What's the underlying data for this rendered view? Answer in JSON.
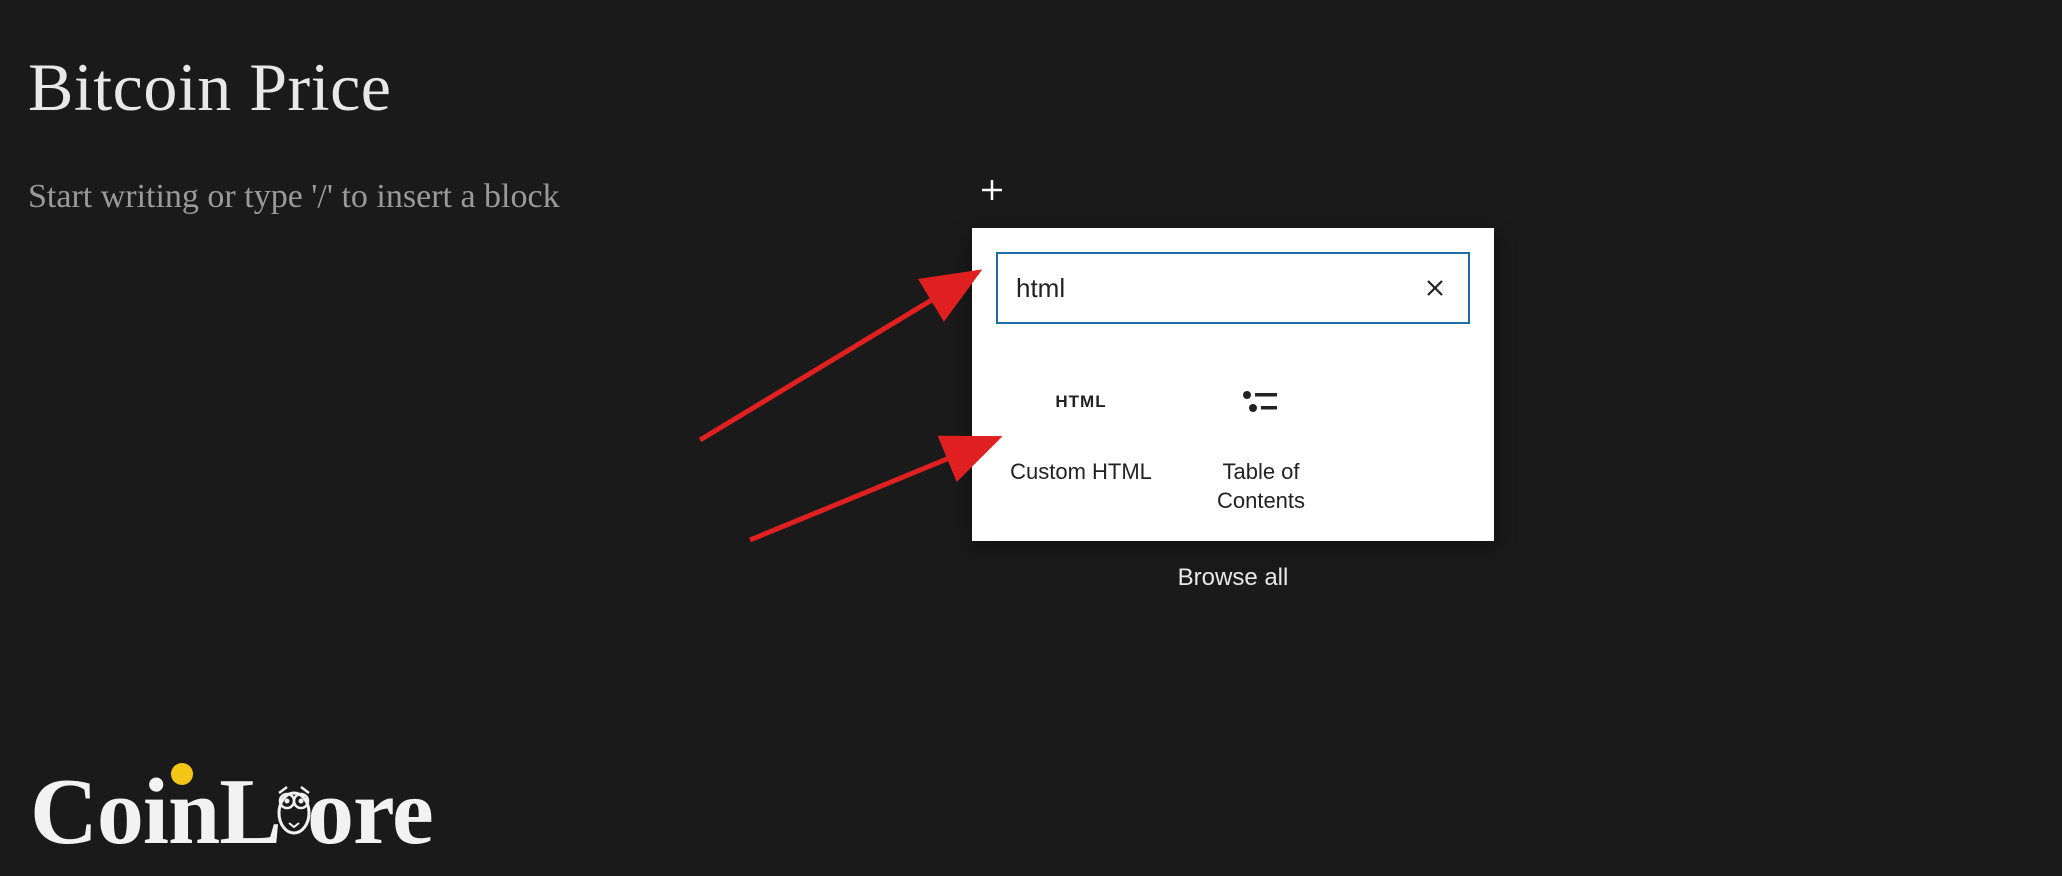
{
  "editor": {
    "page_title": "Bitcoin Price",
    "placeholder": "Start writing or type '/' to insert a block"
  },
  "popover": {
    "search_value": "html",
    "blocks": [
      {
        "label": "Custom HTML",
        "icon": "html"
      },
      {
        "label": "Table of\nContents",
        "icon": "toc"
      }
    ],
    "browse_all_label": "Browse all"
  },
  "branding": {
    "logo_text_before": "Coin",
    "logo_text_after": "ore",
    "logo_letter_l": "L"
  },
  "annotations": {
    "arrows_color": "#e02020"
  }
}
